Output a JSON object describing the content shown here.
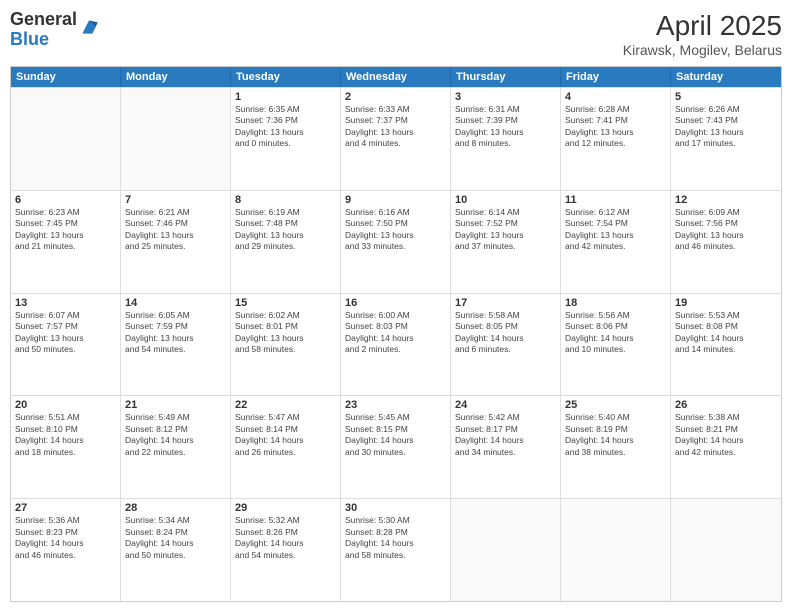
{
  "logo": {
    "general": "General",
    "blue": "Blue"
  },
  "title": "April 2025",
  "subtitle": "Kirawsk, Mogilev, Belarus",
  "days_of_week": [
    "Sunday",
    "Monday",
    "Tuesday",
    "Wednesday",
    "Thursday",
    "Friday",
    "Saturday"
  ],
  "weeks": [
    [
      {
        "day": "",
        "info": "",
        "empty": true
      },
      {
        "day": "",
        "info": "",
        "empty": true
      },
      {
        "day": "1",
        "info": "Sunrise: 6:35 AM\nSunset: 7:36 PM\nDaylight: 13 hours\nand 0 minutes."
      },
      {
        "day": "2",
        "info": "Sunrise: 6:33 AM\nSunset: 7:37 PM\nDaylight: 13 hours\nand 4 minutes."
      },
      {
        "day": "3",
        "info": "Sunrise: 6:31 AM\nSunset: 7:39 PM\nDaylight: 13 hours\nand 8 minutes."
      },
      {
        "day": "4",
        "info": "Sunrise: 6:28 AM\nSunset: 7:41 PM\nDaylight: 13 hours\nand 12 minutes."
      },
      {
        "day": "5",
        "info": "Sunrise: 6:26 AM\nSunset: 7:43 PM\nDaylight: 13 hours\nand 17 minutes."
      }
    ],
    [
      {
        "day": "6",
        "info": "Sunrise: 6:23 AM\nSunset: 7:45 PM\nDaylight: 13 hours\nand 21 minutes."
      },
      {
        "day": "7",
        "info": "Sunrise: 6:21 AM\nSunset: 7:46 PM\nDaylight: 13 hours\nand 25 minutes."
      },
      {
        "day": "8",
        "info": "Sunrise: 6:19 AM\nSunset: 7:48 PM\nDaylight: 13 hours\nand 29 minutes."
      },
      {
        "day": "9",
        "info": "Sunrise: 6:16 AM\nSunset: 7:50 PM\nDaylight: 13 hours\nand 33 minutes."
      },
      {
        "day": "10",
        "info": "Sunrise: 6:14 AM\nSunset: 7:52 PM\nDaylight: 13 hours\nand 37 minutes."
      },
      {
        "day": "11",
        "info": "Sunrise: 6:12 AM\nSunset: 7:54 PM\nDaylight: 13 hours\nand 42 minutes."
      },
      {
        "day": "12",
        "info": "Sunrise: 6:09 AM\nSunset: 7:56 PM\nDaylight: 13 hours\nand 46 minutes."
      }
    ],
    [
      {
        "day": "13",
        "info": "Sunrise: 6:07 AM\nSunset: 7:57 PM\nDaylight: 13 hours\nand 50 minutes."
      },
      {
        "day": "14",
        "info": "Sunrise: 6:05 AM\nSunset: 7:59 PM\nDaylight: 13 hours\nand 54 minutes."
      },
      {
        "day": "15",
        "info": "Sunrise: 6:02 AM\nSunset: 8:01 PM\nDaylight: 13 hours\nand 58 minutes."
      },
      {
        "day": "16",
        "info": "Sunrise: 6:00 AM\nSunset: 8:03 PM\nDaylight: 14 hours\nand 2 minutes."
      },
      {
        "day": "17",
        "info": "Sunrise: 5:58 AM\nSunset: 8:05 PM\nDaylight: 14 hours\nand 6 minutes."
      },
      {
        "day": "18",
        "info": "Sunrise: 5:56 AM\nSunset: 8:06 PM\nDaylight: 14 hours\nand 10 minutes."
      },
      {
        "day": "19",
        "info": "Sunrise: 5:53 AM\nSunset: 8:08 PM\nDaylight: 14 hours\nand 14 minutes."
      }
    ],
    [
      {
        "day": "20",
        "info": "Sunrise: 5:51 AM\nSunset: 8:10 PM\nDaylight: 14 hours\nand 18 minutes."
      },
      {
        "day": "21",
        "info": "Sunrise: 5:49 AM\nSunset: 8:12 PM\nDaylight: 14 hours\nand 22 minutes."
      },
      {
        "day": "22",
        "info": "Sunrise: 5:47 AM\nSunset: 8:14 PM\nDaylight: 14 hours\nand 26 minutes."
      },
      {
        "day": "23",
        "info": "Sunrise: 5:45 AM\nSunset: 8:15 PM\nDaylight: 14 hours\nand 30 minutes."
      },
      {
        "day": "24",
        "info": "Sunrise: 5:42 AM\nSunset: 8:17 PM\nDaylight: 14 hours\nand 34 minutes."
      },
      {
        "day": "25",
        "info": "Sunrise: 5:40 AM\nSunset: 8:19 PM\nDaylight: 14 hours\nand 38 minutes."
      },
      {
        "day": "26",
        "info": "Sunrise: 5:38 AM\nSunset: 8:21 PM\nDaylight: 14 hours\nand 42 minutes."
      }
    ],
    [
      {
        "day": "27",
        "info": "Sunrise: 5:36 AM\nSunset: 8:23 PM\nDaylight: 14 hours\nand 46 minutes."
      },
      {
        "day": "28",
        "info": "Sunrise: 5:34 AM\nSunset: 8:24 PM\nDaylight: 14 hours\nand 50 minutes."
      },
      {
        "day": "29",
        "info": "Sunrise: 5:32 AM\nSunset: 8:26 PM\nDaylight: 14 hours\nand 54 minutes."
      },
      {
        "day": "30",
        "info": "Sunrise: 5:30 AM\nSunset: 8:28 PM\nDaylight: 14 hours\nand 58 minutes."
      },
      {
        "day": "",
        "info": "",
        "empty": true
      },
      {
        "day": "",
        "info": "",
        "empty": true
      },
      {
        "day": "",
        "info": "",
        "empty": true
      }
    ]
  ]
}
